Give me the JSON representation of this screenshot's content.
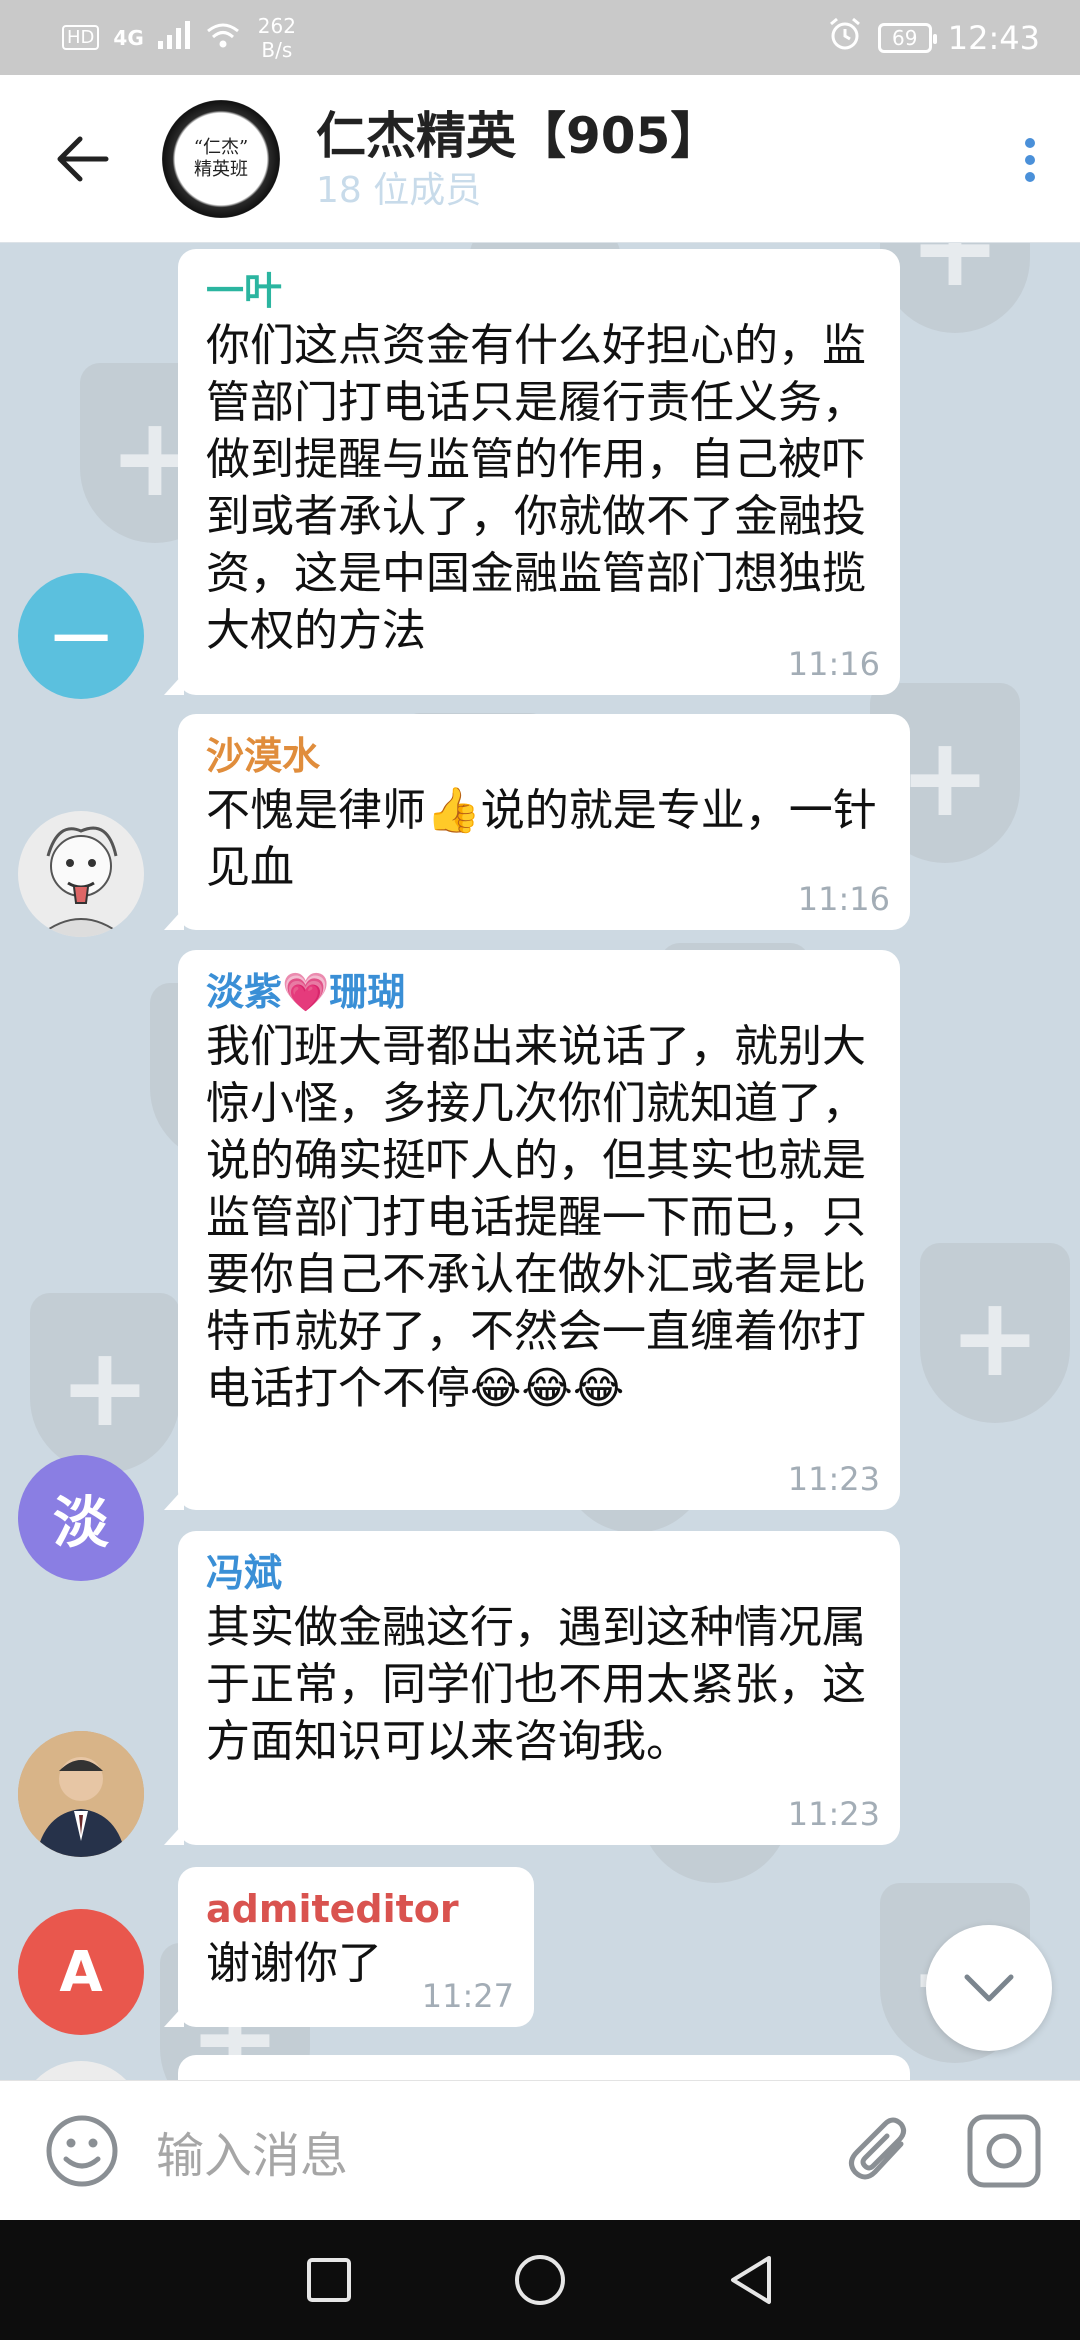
{
  "status_bar": {
    "network": "4G",
    "hd": "HD",
    "speed_value": "262",
    "speed_unit": "B/s",
    "battery": "69",
    "time": "12:43"
  },
  "header": {
    "title": "仁杰精英【905】",
    "subtitle": "18 位成员",
    "avatar_line1": "“仁杰”",
    "avatar_line2": "精英班"
  },
  "messages": [
    {
      "sender": "一叶",
      "sender_color": "#2bb5a0",
      "avatar_letter": "一",
      "avatar_color": "#5bc0de",
      "text": "你们这点资金有什么好担心的，监管部门打电话只是履行责任义务，做到提醒与监管的作用，自己被吓到或者承认了，你就做不了金融投资，这是中国金融监管部门想独揽大权的方法",
      "time": "11:16"
    },
    {
      "sender": "沙漠水",
      "sender_color": "#e08d3c",
      "avatar_letter": "",
      "avatar_color": "#e9e9e9",
      "text": "不愧是律师👍说的就是专业，一针见血",
      "time": "11:16"
    },
    {
      "sender": "淡紫💗珊瑚",
      "sender_color": "#3a8fd6",
      "avatar_letter": "淡",
      "avatar_color": "#8a7ee3",
      "text": "我们班大哥都出来说话了，就别大惊小怪，多接几次你们就知道了，说的确实挺吓人的，但其实也就是监管部门打电话提醒一下而已，只要你自己不承认在做外汇或者是比特币就好了，不然会一直缠着你打电话打个不停😂😂😂",
      "time": "11:23"
    },
    {
      "sender": "冯斌",
      "sender_color": "#3a8fd6",
      "avatar_letter": "",
      "avatar_color": "#b08a5e",
      "text": "其实做金融这行，遇到这种情况属于正常，同学们也不用太紧张，这方面知识可以来咨询我。",
      "time": "11:23"
    },
    {
      "sender": "admiteditor",
      "sender_color": "#d9534f",
      "avatar_letter": "A",
      "avatar_color": "#e9574d",
      "text": "谢谢你了",
      "time": "11:27"
    }
  ],
  "input": {
    "placeholder": "输入消息"
  }
}
